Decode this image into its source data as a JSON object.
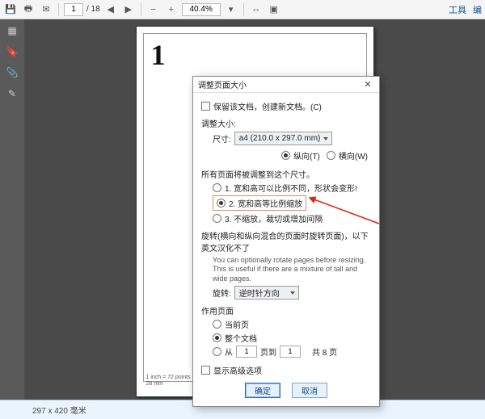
{
  "toolbar": {
    "page_current": "1",
    "page_total": "/ 18",
    "zoom": "40.4%"
  },
  "topbar_right": {
    "tools": "工具",
    "more": "编"
  },
  "page": {
    "big_number": "1",
    "footer1": "1 inch = 72 points",
    "footer2": "28 mm"
  },
  "statusbar": {
    "dims": "297 x 420 毫米"
  },
  "dialog": {
    "title": "调整页面大小",
    "keep_doc_label": "保留该文档，创建新文档。(C)",
    "size_group": "调整大小:",
    "size_label": "尺寸:",
    "size_value": "a4 (210.0 x 297.0 mm)",
    "orient_portrait": "纵向(T)",
    "orient_landscape": "横向(W)",
    "fit_group": "所有页面将被调整到这个尺寸。",
    "opt1": "1. 宽和高可以比例不同，形状会变形!",
    "opt2": "2. 宽和高等比例缩放",
    "opt3": "3. 不缩放，裁切或增加间隔",
    "rotate_group": "旋转(横向和纵向混合的页面时旋转页面)，以下英文汉化不了",
    "rotate_note": "You can optionally rotate pages before resizing. This is useful if there are a mixture of tall and wide pages.",
    "rotate_label": "旋转:",
    "rotate_value": "逆时针方向",
    "apply_group": "作用页面",
    "apply_current": "当前页",
    "apply_all": "整个文档",
    "apply_from": "从",
    "from_val": "1",
    "to_label": "页到",
    "to_val": "1",
    "total_label": "共 8 页",
    "show_advanced": "显示高级选项",
    "ok": "确定",
    "cancel": "取消"
  }
}
